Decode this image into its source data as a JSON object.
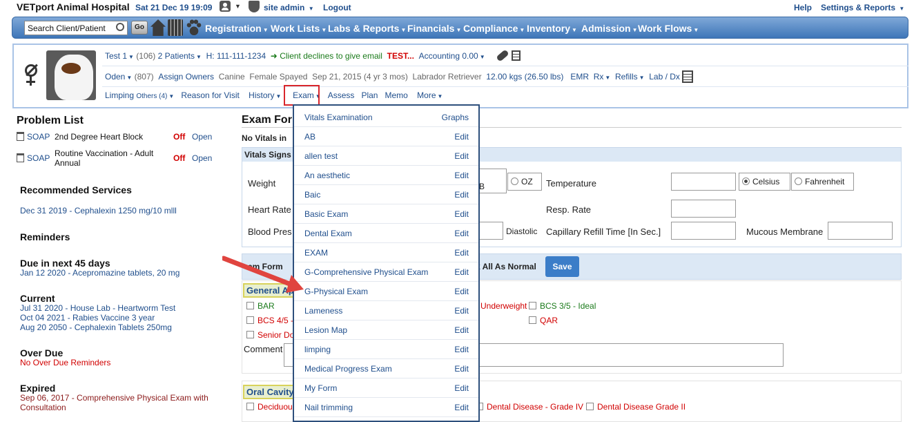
{
  "topbar": {
    "hospital": "VETport Animal Hospital",
    "datetime": "Sat 21 Dec 19 19:09",
    "user": "site admin",
    "logout": "Logout",
    "help": "Help",
    "settings": "Settings & Reports"
  },
  "navbar": {
    "search_placeholder": "Search Client/Patient",
    "go": "Go",
    "menus": [
      "Registration",
      "Work Lists",
      "Labs & Reports",
      "Financials",
      "Compliance",
      "Inventory",
      "Admission",
      "Work Flows"
    ]
  },
  "patient": {
    "client": "Test 1",
    "client_count": "(106)",
    "patients": "2  Patients",
    "phone": "H: 111-111-1234",
    "email_note": "Client declines to give email",
    "alert": "TEST...",
    "accounting": "Accounting 0.00",
    "name": "Oden",
    "pet_id": "(807)",
    "assign_owners": "Assign Owners",
    "species": "Canine",
    "sex": "Female Spayed",
    "dob": "Sep 21, 2015 (4 yr 3 mos)",
    "breed": "Labrador Retriever",
    "weight": "12.00 kgs (26.50 lbs)",
    "emr": "EMR",
    "rx": "Rx",
    "refills": "Refills",
    "labdx": "Lab / Dx",
    "tabs": {
      "limping": "Limping",
      "others": "Others (4)",
      "reason": "Reason for Visit",
      "history": "History",
      "exam": "Exam",
      "assess": "Assess",
      "plan": "Plan",
      "memo": "Memo",
      "more": "More"
    }
  },
  "problem_list": {
    "title": "Problem List",
    "items": [
      {
        "soap": "SOAP",
        "name": "2nd Degree Heart Block",
        "status": "Off",
        "link": "Open"
      },
      {
        "soap": "SOAP",
        "name": "Routine Vaccination - Adult Annual",
        "status": "Off",
        "link": "Open"
      }
    ],
    "recommended_title": "Recommended Services",
    "recommended": [
      "Dec 31 2019 - Cephalexin 1250 mg/10 mlll"
    ],
    "reminders_title": "Reminders",
    "due_title": "Due in next 45 days",
    "due": [
      "Jan 12 2020 - Acepromazine tablets, 20 mg"
    ],
    "current_title": "Current",
    "current": [
      "Jul 31 2020 - House Lab - Heartworm Test",
      "Oct 04 2021 - Rabies Vaccine 3 year",
      "Aug 20 2050 - Cephalexin Tablets 250mg"
    ],
    "overdue_title": "Over Due",
    "overdue": "No Over Due Reminders",
    "expired_title": "Expired",
    "expired": [
      "Sep 06, 2017 - Comprehensive Physical Exam with",
      "Consultation"
    ]
  },
  "exam": {
    "title": "Exam For",
    "no_vitals": "No Vitals in",
    "vitals_header": "Vitals Signs",
    "weight": "Weight",
    "oz": "OZ",
    "lb": "B",
    "temperature": "Temperature",
    "celsius": "Celsius",
    "fahrenheit": "Fahrenheit",
    "heart_rate": "Heart Rate",
    "resp_rate": "Resp. Rate",
    "blood_pressure": "Blood Pres",
    "diastolic": "Diastolic",
    "capillary": "Capillary Refill Time [In Sec.]",
    "mucous": "Mucous Membrane",
    "exam_form": "am Form",
    "mark_normal": "k All As Normal",
    "save": "Save",
    "general_section": "General Ap",
    "general_items": [
      "BAR",
      "BCS 4/5 -",
      "Senior Do"
    ],
    "underweight": "Underweight",
    "bcs_ideal": "BCS 3/5 - Ideal",
    "qar": "QAR",
    "comment": "Comment",
    "oral_section": "Oral Cavity",
    "deciduous": "Deciduou",
    "dental4": "Dental Disease - Grade IV",
    "dental2": "Dental Disease Grade II"
  },
  "dropdown": {
    "header": "Vitals Examination",
    "graphs": "Graphs",
    "edit": "Edit",
    "items": [
      "AB",
      "allen test",
      "An aesthetic",
      "Baic",
      "Basic Exam",
      "Dental Exam",
      "EXAM",
      "G-Comprehensive Physical Exam",
      "G-Physical Exam",
      "Lameness",
      "Lesion Map",
      "limping",
      "Medical Progress Exam",
      "My Form",
      "Nail trimming"
    ]
  },
  "colors": {
    "accent": "#1f4e8c",
    "nav": "#4a80c2",
    "alert": "#d10000",
    "highlight": "#d9262b",
    "arrow": "#e0443f"
  }
}
